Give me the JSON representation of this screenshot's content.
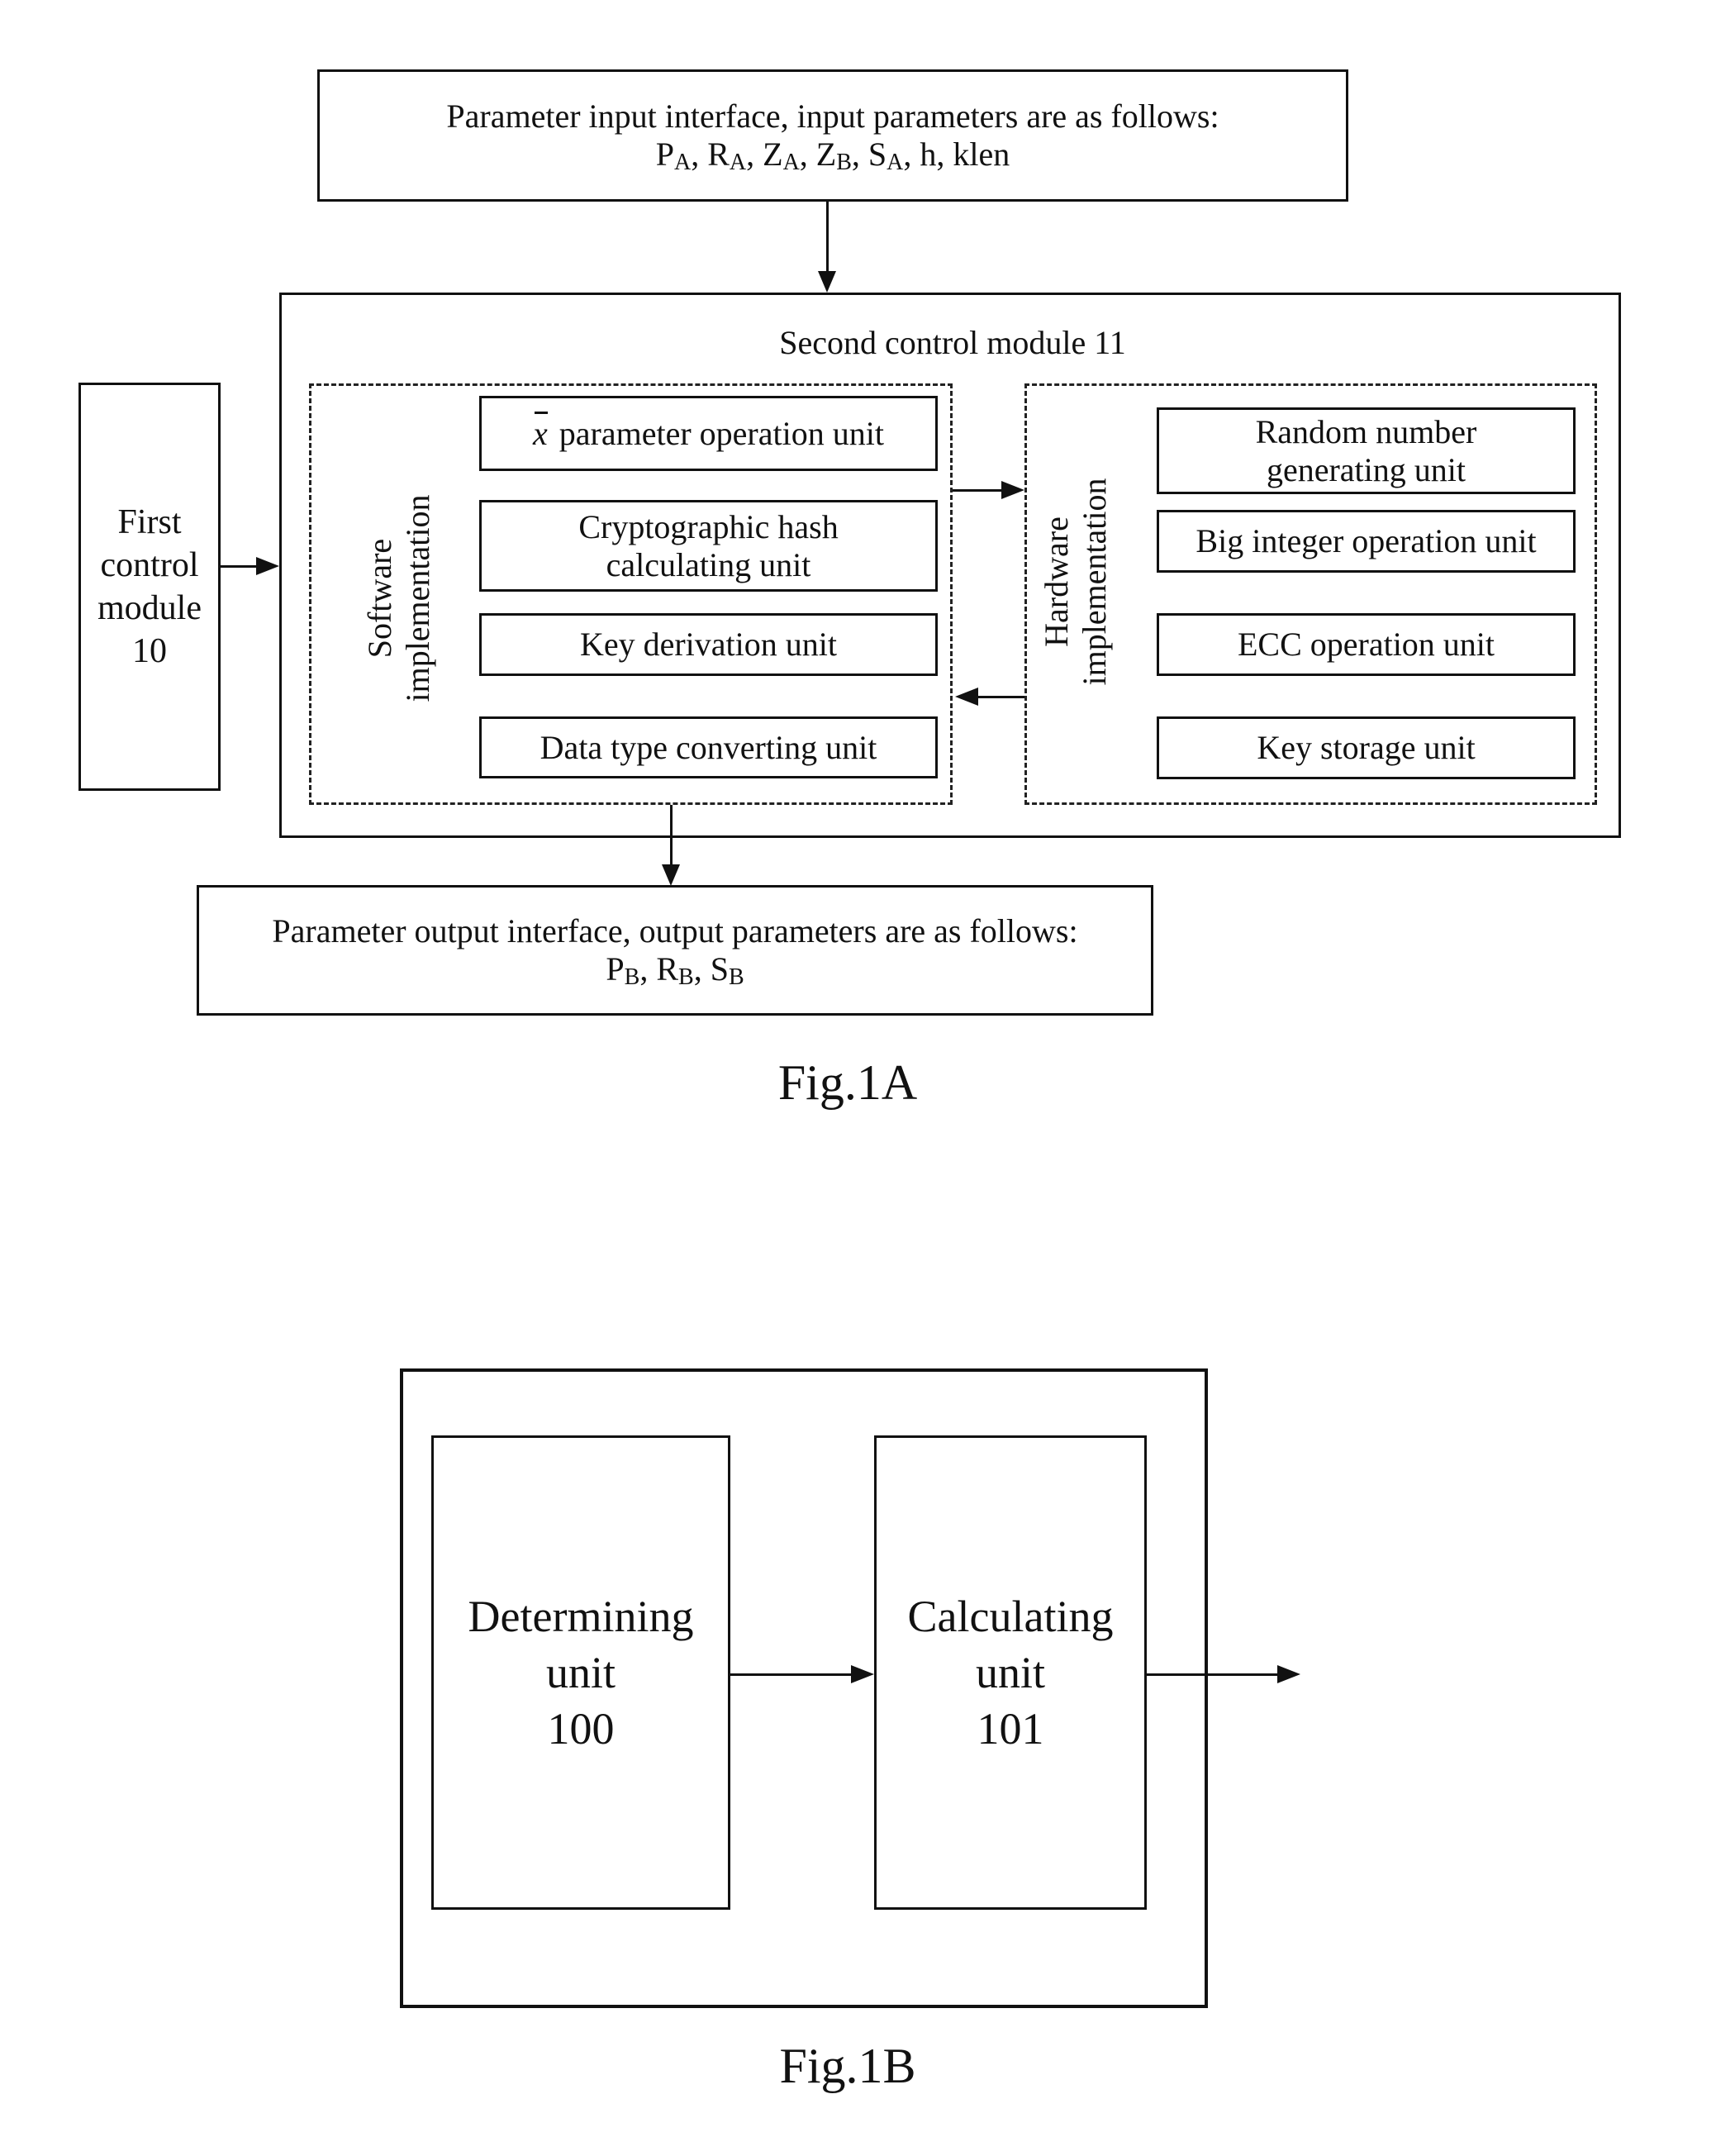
{
  "fig1a": {
    "caption": "Fig.1A",
    "input_interface": {
      "line1": "Parameter input interface, input parameters are as follows:",
      "params": [
        {
          "base": "P",
          "sub": "A"
        },
        {
          "base": "R",
          "sub": "A"
        },
        {
          "base": "Z",
          "sub": "A"
        },
        {
          "base": "Z",
          "sub": "B"
        },
        {
          "base": "S",
          "sub": "A"
        },
        {
          "base": "h",
          "sub": ""
        },
        {
          "base": "klen",
          "sub": ""
        }
      ]
    },
    "first_control": {
      "lines": [
        "First",
        "control",
        "module",
        "10"
      ]
    },
    "second_control": {
      "title": "Second control module 11",
      "software": {
        "label_line1": "Software",
        "label_line2": "implementation",
        "units": [
          {
            "symbol": "x",
            "label": "parameter operation unit"
          },
          {
            "label_line1": "Cryptographic hash",
            "label_line2": "calculating unit"
          },
          {
            "label": "Key derivation unit"
          },
          {
            "label": "Data type converting unit"
          }
        ]
      },
      "hardware": {
        "label_line1": "Hardware",
        "label_line2": "implementation",
        "units": [
          {
            "label_line1": "Random number",
            "label_line2": "generating unit"
          },
          {
            "label": "Big integer operation unit"
          },
          {
            "label": "ECC operation unit"
          },
          {
            "label": "Key storage unit"
          }
        ]
      }
    },
    "output_interface": {
      "line1": "Parameter output interface, output parameters are as follows:",
      "params": [
        {
          "base": "P",
          "sub": "B"
        },
        {
          "base": "R",
          "sub": "B"
        },
        {
          "base": "S",
          "sub": "B"
        }
      ]
    }
  },
  "fig1b": {
    "caption": "Fig.1B",
    "determining_unit": {
      "lines": [
        "Determining",
        "unit",
        "100"
      ]
    },
    "calculating_unit": {
      "lines": [
        "Calculating",
        "unit",
        "101"
      ]
    }
  }
}
